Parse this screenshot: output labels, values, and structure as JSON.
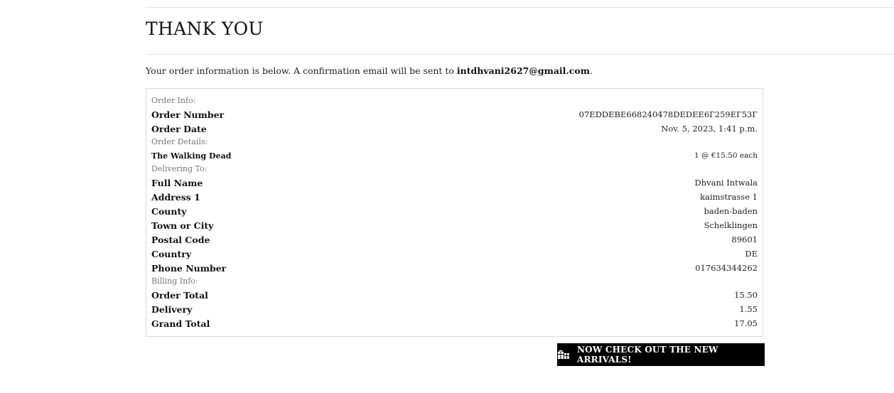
{
  "page": {
    "title": "THANK YOU",
    "intro_text": "Your order information is below. A confirmation email will be sent to ",
    "email": "intdhvani2627@gmail.com",
    "intro_end": "."
  },
  "order_info": {
    "section_label": "Order Info:",
    "rows": [
      {
        "label": "Order Number",
        "value": "07EDDEBE668240478DEDEE6Г259EГ53Г"
      },
      {
        "label": "Order Date",
        "value": "Nov. 5, 2023, 1:41 p.m."
      }
    ]
  },
  "order_details": {
    "section_label": "Order Details:",
    "items": [
      {
        "name": "The Walking Dead",
        "qty_price": "1 @ €15.50 each"
      }
    ]
  },
  "delivering_to": {
    "section_label": "Delivering To:",
    "rows": [
      {
        "label": "Full Name",
        "value": "Dhvani Intwala"
      },
      {
        "label": "Address 1",
        "value": "kaimstrasse 1"
      },
      {
        "label": "County",
        "value": "baden-baden"
      },
      {
        "label": "Town or City",
        "value": "Schelklingen"
      },
      {
        "label": "Postal Code",
        "value": "89601"
      },
      {
        "label": "Country",
        "value": "DE"
      },
      {
        "label": "Phone Number",
        "value": "017634344262"
      }
    ]
  },
  "billing_info": {
    "section_label": "Billing Info:",
    "rows": [
      {
        "label": "Order Total",
        "value": "15.50"
      },
      {
        "label": "Delivery",
        "value": "1.55"
      },
      {
        "label": "Grand Total",
        "value": "17.05"
      }
    ]
  },
  "cta": {
    "label": "NOW CHECK OUT THE NEW ARRIVALS!",
    "icon": "gift-icon"
  }
}
